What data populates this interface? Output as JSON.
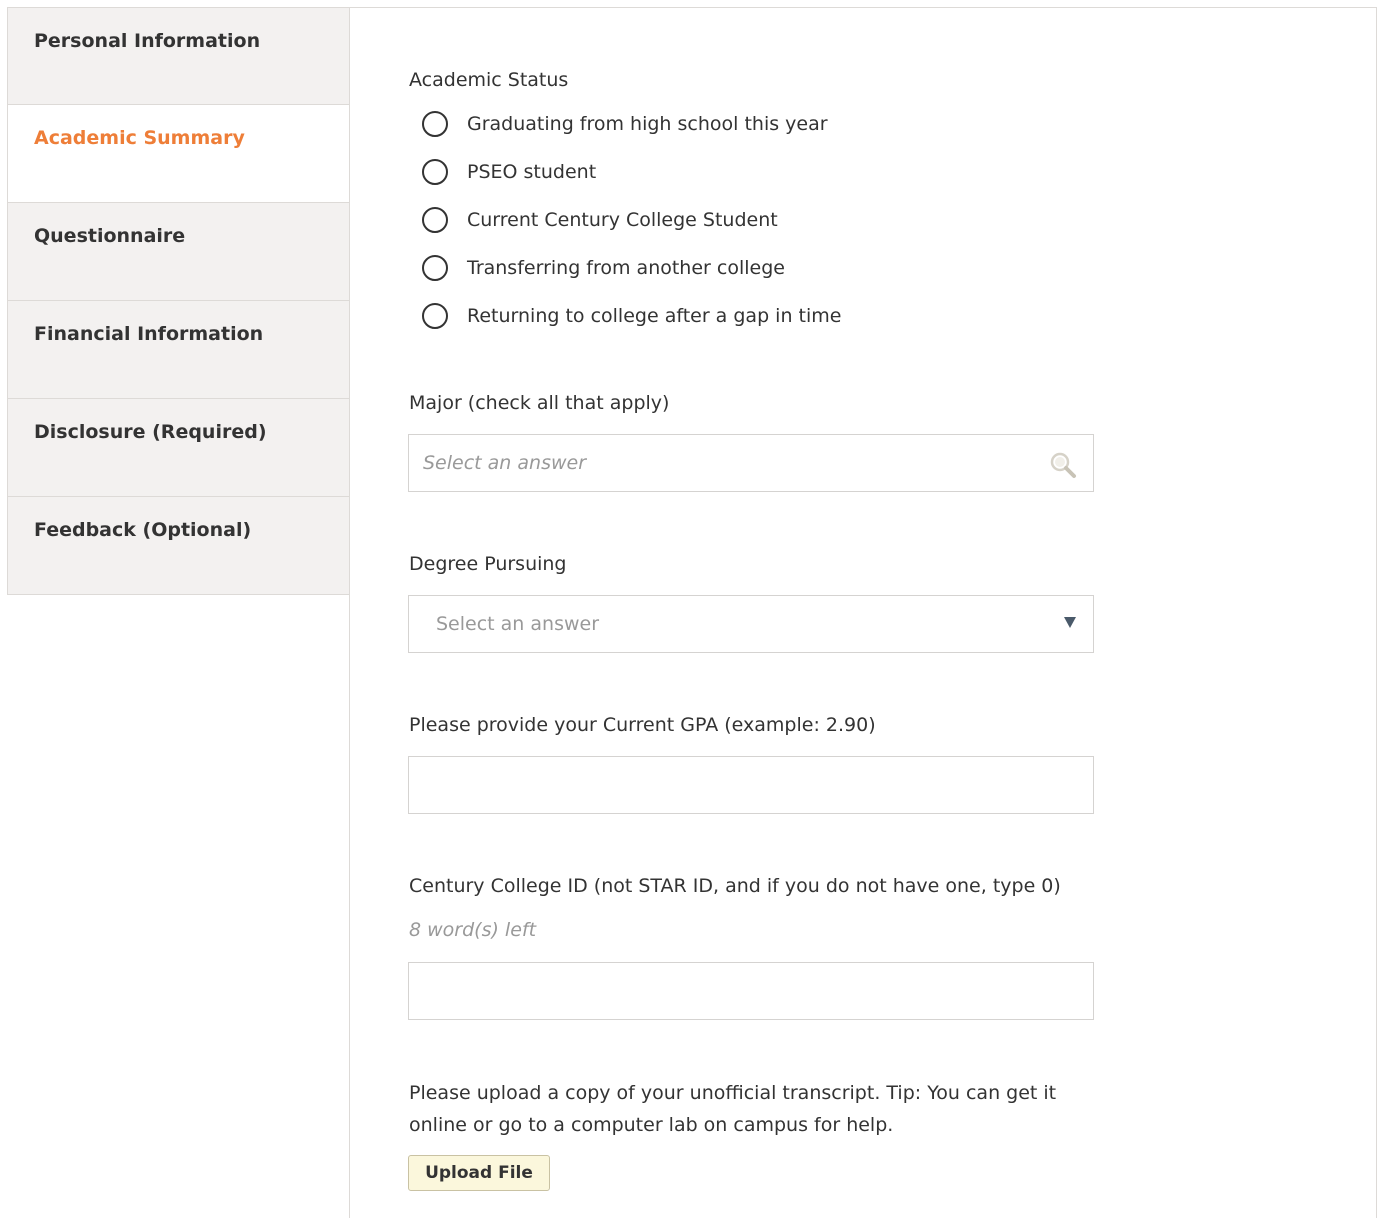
{
  "sidebar": {
    "items": [
      {
        "label": "Personal Information"
      },
      {
        "label": "Academic Summary"
      },
      {
        "label": "Questionnaire"
      },
      {
        "label": "Financial Information"
      },
      {
        "label": "Disclosure (Required)"
      },
      {
        "label": "Feedback (Optional)"
      }
    ],
    "active_index": 1
  },
  "form": {
    "academic_status": {
      "label": "Academic Status",
      "options": [
        "Graduating from high school this year",
        "PSEO student",
        "Current Century College Student",
        "Transferring from another college",
        "Returning to college after a gap in time"
      ]
    },
    "major": {
      "label": "Major (check all that apply)",
      "placeholder": "Select an answer"
    },
    "degree": {
      "label": "Degree Pursuing",
      "placeholder": "Select an answer"
    },
    "gpa": {
      "label": "Please provide your Current GPA (example: 2.90)",
      "value": ""
    },
    "college_id": {
      "label": "Century College ID (not STAR ID, and if you do not have one, type 0)",
      "hint": "8 word(s) left",
      "value": ""
    },
    "transcript": {
      "label": "Please upload a copy of your unofficial transcript. Tip: You can get it online or go to a computer lab on campus for help.",
      "button_label": "Upload File"
    }
  },
  "colors": {
    "accent": "#ee7e38",
    "sidebar_bg": "#f3f1f0",
    "border": "#dddad7",
    "upload_button_bg": "#fbf7dc"
  },
  "icons": {
    "major_search": "search-icon",
    "degree_caret": "caret-down-icon"
  }
}
